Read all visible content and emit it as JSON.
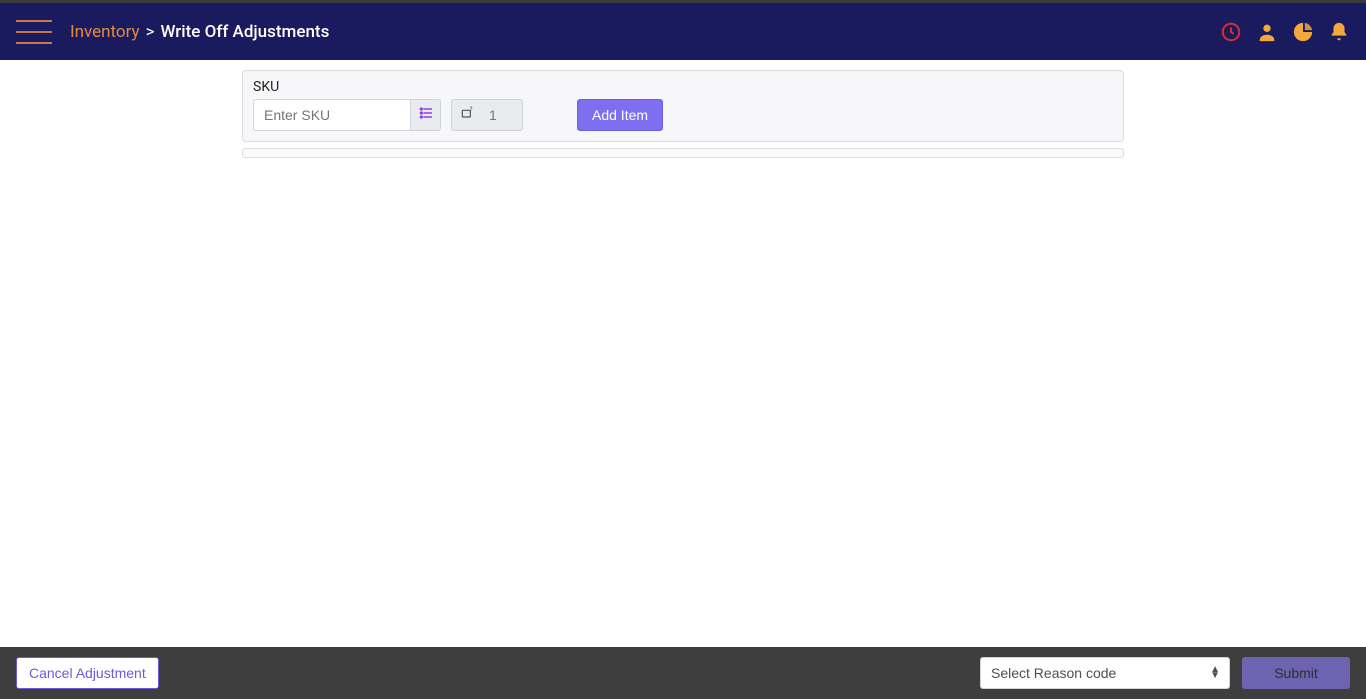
{
  "header": {
    "breadcrumb": {
      "root": "Inventory",
      "sep": ">",
      "current": "Write Off Adjustments"
    }
  },
  "sku_card": {
    "label": "SKU",
    "input_placeholder": "Enter SKU",
    "quantity_value": "1",
    "add_button": "Add Item"
  },
  "footer": {
    "cancel_button": "Cancel Adjustment",
    "reason_select_placeholder": "Select Reason code",
    "submit_button": "Submit"
  },
  "colors": {
    "header_bg": "#1a1a5e",
    "accent_orange": "#f3a83b",
    "accent_red": "#d32f2f",
    "primary_purple": "#7d6ff0"
  }
}
